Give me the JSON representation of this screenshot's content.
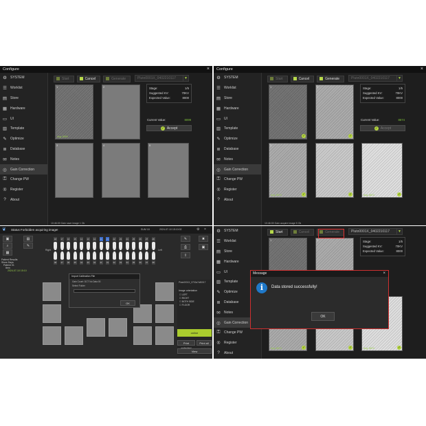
{
  "window": {
    "title": "Configure",
    "close_glyph": "×"
  },
  "nav": [
    {
      "label": "SYSTEM",
      "icon": "gear-icon",
      "glyph": "⚙"
    },
    {
      "label": "Worklist",
      "icon": "list-icon",
      "glyph": "☰"
    },
    {
      "label": "Store",
      "icon": "storage-icon",
      "glyph": "▤"
    },
    {
      "label": "Hardware",
      "icon": "hardware-icon",
      "glyph": "▦"
    },
    {
      "label": "UI",
      "icon": "ui-icon",
      "glyph": "▭"
    },
    {
      "label": "Template",
      "icon": "template-icon",
      "glyph": "▥"
    },
    {
      "label": "Optimize",
      "icon": "optimize-icon",
      "glyph": "✎"
    },
    {
      "label": "Database",
      "icon": "database-icon",
      "glyph": "≣"
    },
    {
      "label": "Notes",
      "icon": "notes-icon",
      "glyph": "✉"
    },
    {
      "label": "Gain Correction",
      "icon": "gain-correction-icon",
      "glyph": "◎"
    },
    {
      "label": "Change PW",
      "icon": "key-icon",
      "glyph": "⚿"
    },
    {
      "label": "Register",
      "icon": "register-icon",
      "glyph": "®"
    },
    {
      "label": "About",
      "icon": "help-icon",
      "glyph": "?"
    }
  ],
  "toolbar": {
    "start_label": "Start",
    "cancel_label": "Cancel",
    "generate_label": "Generate"
  },
  "detector": {
    "name": "Pluto0001X_0402210117",
    "arrow": "▼"
  },
  "stage": {
    "stage_label": "Stage:",
    "stage_value": "1/5",
    "kv_label": "Suggested KV:",
    "kv_value": "70KV",
    "expected_label": "Expected Value:",
    "expected_value": "8000"
  },
  "current": {
    "label": "Current Value:",
    "panel1_value": "8099",
    "panel2_value": "8674"
  },
  "accept_label": "Accept",
  "status": {
    "panel1": "10:46:09 Gain save image 1 Ok",
    "panel2": "10:46:09 Gain acquire image 5 Ok"
  },
  "tile_values": {
    "t1": "Avg: 8099",
    "t5": "Avg: 8674",
    "t6": "Avg: 8674",
    "t7": "Avg: 8674",
    "t8": "Avg: 8674"
  },
  "tile_indices": [
    "1",
    "2",
    "3",
    "4",
    "5",
    "6"
  ],
  "dialog": {
    "title": "Message",
    "message": "Data stored successfully!",
    "ok_label": "OK",
    "icon_glyph": "i"
  },
  "acq": {
    "title": "Status Forbidden acquiring image!",
    "info1": "SUM 18",
    "info2": "2024-07-10 15:10:02",
    "tooth_numbers_top": [
      "18",
      "17",
      "16",
      "15",
      "14",
      "13",
      "12",
      "11",
      "21",
      "22",
      "23",
      "24",
      "25",
      "26",
      "27",
      "28"
    ],
    "tooth_numbers_bottom": [
      "48",
      "47",
      "46",
      "45",
      "44",
      "43",
      "42",
      "41",
      "31",
      "32",
      "33",
      "34",
      "35",
      "36",
      "37",
      "38"
    ],
    "left_label": "Right",
    "right_label": "Left",
    "tree": [
      "Patient Results",
      "Show Days",
      "Patient 01",
      "Item",
      "2024-07-10 15:10"
    ],
    "dialog_title": "Import Calibration File",
    "dialog_line1": "Gain Count: DCT No Data 00",
    "dialog_line2": "Select Folder",
    "dialog_ok": "OK",
    "detector_label": "Pluto0001X_0702a7c80017",
    "options_title": "Image orientation",
    "options": [
      "LEFT",
      "RIGHT",
      "BOTH SIDE",
      "FLOOR"
    ],
    "online_label": "online",
    "print_selected": "Print selected",
    "print_all": "Print all",
    "view_label": "View"
  },
  "colors": {
    "accent": "#b4d63e",
    "value_green": "#7fc23a",
    "highlight_red": "#e03030",
    "info_blue": "#1f78c8"
  }
}
